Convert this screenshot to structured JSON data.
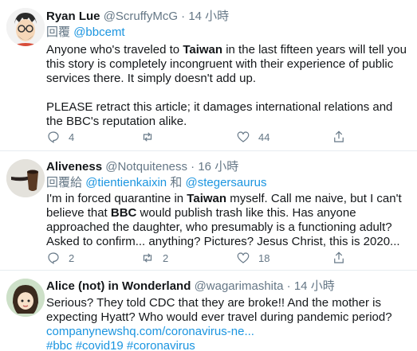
{
  "tweets": [
    {
      "name": "Ryan Lue",
      "handle": "@ScruffyMcG",
      "dot": "·",
      "time": "14 小時",
      "reply_prefix": "回覆",
      "reply_to": "@bbcemt",
      "text": {
        "p1a": "Anyone who's traveled to ",
        "p1b": "Taiwan",
        "p1c": " in the last fifteen years will tell you this story is completely incongruent with their experience of public services there. It simply doesn't add up.",
        "p2": "PLEASE retract this article; it damages international relations and the BBC's reputation alike."
      },
      "replies": "4",
      "retweets": "",
      "likes": "44"
    },
    {
      "name": "Aliveness",
      "handle": "@Notquiteness",
      "dot": "·",
      "time": "16 小時",
      "reply_prefix": "回覆給",
      "reply_to_1": "@tientienkaixin",
      "reply_and": "和",
      "reply_to_2": "@stegersaurus",
      "text": {
        "a": "I'm in forced quarantine in ",
        "b": "Taiwan",
        "c": " myself. Call me naive, but I can't believe that ",
        "d": "BBC",
        "e": " would publish trash like this. Has anyone approached the daughter, who presumably is a functioning adult? Asked to confirm... anything? Pictures? Jesus Christ, this is 2020..."
      },
      "replies": "2",
      "retweets": "2",
      "likes": "18"
    },
    {
      "name": "Alice (not) in Wonderland",
      "handle": "@wagarimashita",
      "dot": "·",
      "time": "14 小時",
      "text": "Serious? They told CDC that they are broke!! And the mother is expecting Hyatt? Who would ever travel during pandemic period?",
      "link": "companynewshq.com/coronavirus-ne...",
      "hashtags": [
        "#bbc",
        "#covid19",
        "#coronavirus"
      ]
    }
  ],
  "colors": {
    "link": "#1b95e0",
    "muted": "#657786",
    "divider": "#e6ecf0"
  },
  "icons": [
    "reply-icon",
    "retweet-icon",
    "like-icon",
    "share-icon"
  ]
}
